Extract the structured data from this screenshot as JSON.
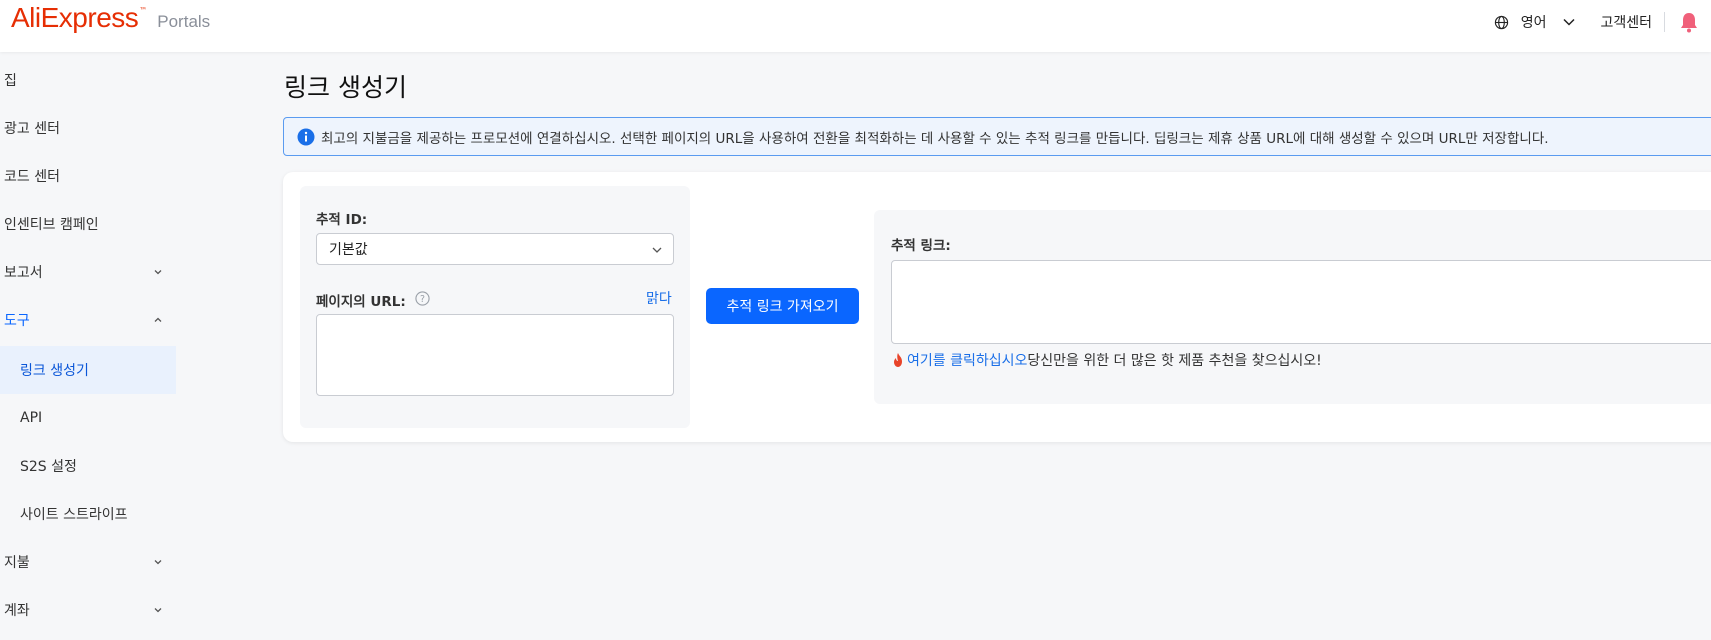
{
  "header": {
    "logo_text": "AliExpress",
    "logo_tm": "™",
    "logo_portals": "Portals",
    "language": "영어",
    "customer_center": "고객센터",
    "icons": [
      "globe-icon",
      "chevron-down-icon",
      "bell-icon"
    ],
    "bell_color": "#f0607a"
  },
  "sidebar": {
    "items": [
      {
        "label": "집"
      },
      {
        "label": "광고 센터"
      },
      {
        "label": "코드 센터"
      },
      {
        "label": "인센티브 캠페인"
      },
      {
        "label": "보고서"
      },
      {
        "label": "도구"
      },
      {
        "label": "링크 생성기"
      },
      {
        "label": "API"
      },
      {
        "label": "S2S 설정"
      },
      {
        "label": "사이트 스트라이프"
      },
      {
        "label": "지불"
      },
      {
        "label": "계좌"
      }
    ],
    "active_color": "#0a66ff",
    "selected_bg": "#e9f1fd"
  },
  "main": {
    "title": "링크 생성기",
    "info": "최고의 지불금을 제공하는 프로모션에 연결하십시오. 선택한 페이지의 URL을 사용하여 전환을 최적화하는 데 사용할 수 있는 추적 링크를 만듭니다. 딥링크는 제휴 상품 URL에 대해 생성할 수 있으며 URL만 저장합니다.",
    "tracking_id_label": "추적 ID:",
    "tracking_id_value": "기본값",
    "page_url_label": "페이지의 URL:",
    "clear_label": "맑다",
    "page_url_value": "",
    "get_link_button": "추적 링크 가져오기",
    "tracking_link_label": "추적 링크:",
    "tracking_link_value": "",
    "promo_link": "여기를 클릭하십시오",
    "promo_text": "당신만을 위한 더 많은 핫 제품 추천을 찾으십시오!",
    "accent_color": "#0a66ff"
  }
}
